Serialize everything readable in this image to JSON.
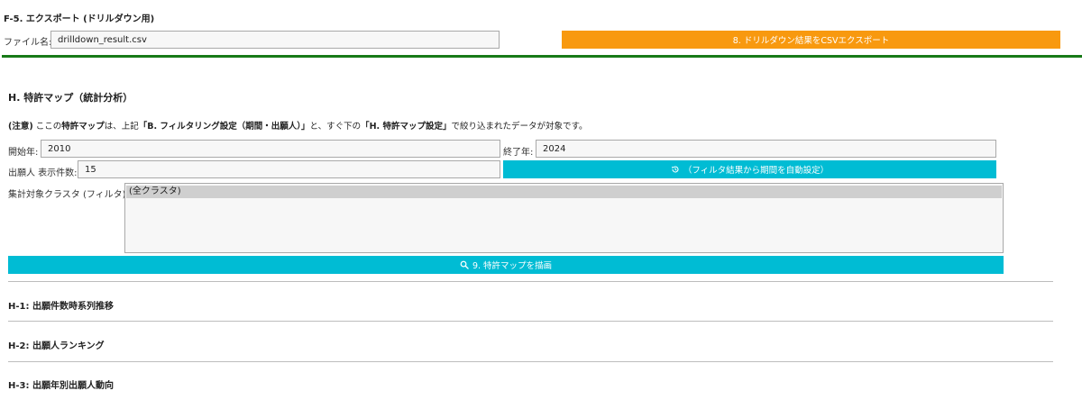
{
  "export_section": {
    "title": "F-5. エクスポート (ドリルダウン用)",
    "filename_label": "ファイル名:",
    "filename_value": "drilldown_result.csv",
    "export_button_label": "8. ドリルダウン結果をCSVエクスポート"
  },
  "patent_map": {
    "title": "H. 特許マップ（統計分析）",
    "note": {
      "prefix": "(注意)",
      "part1": " ここの",
      "bold1": "特許マップ",
      "part2": "は、上記",
      "bold2": "「B. フィルタリング設定（期間・出願人）」",
      "part3": "と、すぐ下の",
      "bold3": "「H. 特許マップ設定」",
      "part4": "で絞り込まれたデータが対象です。"
    },
    "start_year_label": "開始年:",
    "start_year_value": "2010",
    "end_year_label": "終了年:",
    "end_year_value": "2024",
    "applicant_count_label": "出願人 表示件数:",
    "applicant_count_value": "15",
    "auto_period_button_label": "（フィルタ結果から期間を自動設定）",
    "cluster_label": "集計対象クラスタ (フィルタ):",
    "cluster_options": [
      "(全クラスタ)"
    ],
    "draw_button_label": "9. 特許マップを描画"
  },
  "subsections": {
    "h1_title": "H-1: 出願件数時系列推移",
    "h2_title": "H-2: 出願人ランキング",
    "h3_title": "H-3: 出願年別出願人動向"
  },
  "colors": {
    "export_button": "#f8990f",
    "cyan_button": "#00bcd4",
    "green_rule": "#187a18"
  },
  "icons": {
    "auto_period": "history-icon",
    "draw": "search-icon"
  }
}
